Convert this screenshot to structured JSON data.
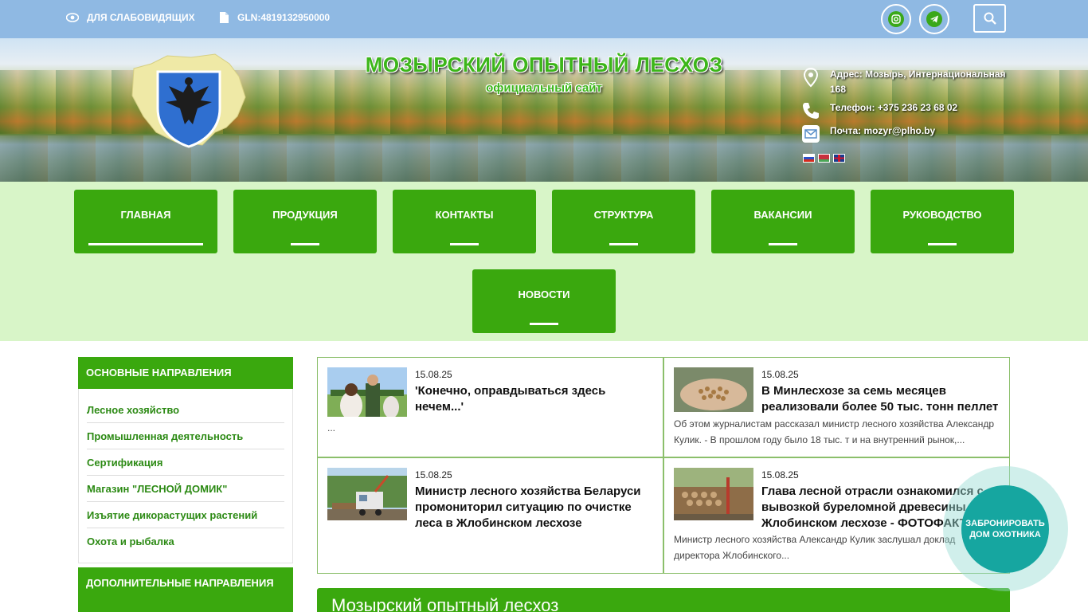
{
  "topbar": {
    "accessibility_label": "ДЛЯ СЛАБОВИДЯЩИХ",
    "gln_label": "GLN:4819132950000",
    "social": [
      "instagram-icon",
      "telegram-icon"
    ],
    "search_icon": "search-icon"
  },
  "header": {
    "title": "МОЗЫРСКИЙ ОПЫТНЫЙ ЛЕСХОЗ",
    "subtitle": "официальный сайт",
    "address": "Адрес: Мозырь, Интернациональная 168",
    "phone": "Телефон: +375 236 23 68 02",
    "email": "Почта: mozyr@plho.by",
    "languages": [
      "ru",
      "be",
      "en"
    ]
  },
  "nav": {
    "items": [
      {
        "label": "ГЛАВНАЯ"
      },
      {
        "label": "ПРОДУКЦИЯ"
      },
      {
        "label": "КОНТАКТЫ"
      },
      {
        "label": "СТРУКТУРА"
      },
      {
        "label": "ВАКАНСИИ"
      },
      {
        "label": "РУКОВОДСТВО"
      },
      {
        "label": "НОВОСТИ"
      }
    ]
  },
  "sidebar": {
    "main_heading": "ОСНОВНЫЕ НАПРАВЛЕНИЯ",
    "items": [
      "Лесное хозяйство",
      "Промышленная деятельность",
      "Сертификация",
      "Магазин \"ЛЕСНОЙ ДОМИК\"",
      "Изъятие дикорастущих растений",
      "Охота и рыбалка"
    ],
    "extra_heading": "ДОПОЛНИТЕЛЬНЫЕ НАПРАВЛЕНИЯ"
  },
  "news": [
    {
      "date": "15.08.25",
      "title": "'Конечно, оправдываться здесь нечем...'",
      "excerpt": "..."
    },
    {
      "date": "15.08.25",
      "title": "В Минлесхозе за семь месяцев реализовали более 50 тыс. тонн пеллет",
      "excerpt": "Об этом журналистам рассказал министр лесного хозяйства Александр Кулик. - В прошлом году было 18 тыс. т и на внутренний рынок,..."
    },
    {
      "date": "15.08.25",
      "title": "Министр лесного хозяйства Беларуси промониторил ситуацию по очистке леса в Жлобинском лесхозе",
      "excerpt": ""
    },
    {
      "date": "15.08.25",
      "title": "Глава лесной отрасли ознакомился с вывозкой буреломной древесины в Жлобинском лесхозе - ФОТОФАКТ",
      "excerpt": "Министр лесного хозяйства Александр Кулик заслушал доклад директора Жлобинского..."
    }
  ],
  "section_title": "Мозырский опытный лесхоз",
  "booking": {
    "label": "ЗАБРОНИРОВАТЬ ДОМ ОХОТНИКА"
  },
  "colors": {
    "topbar": "#8fb9e3",
    "nav_bg": "#d8f5c8",
    "green": "#3aa80e",
    "booking": "#16a6a0"
  }
}
